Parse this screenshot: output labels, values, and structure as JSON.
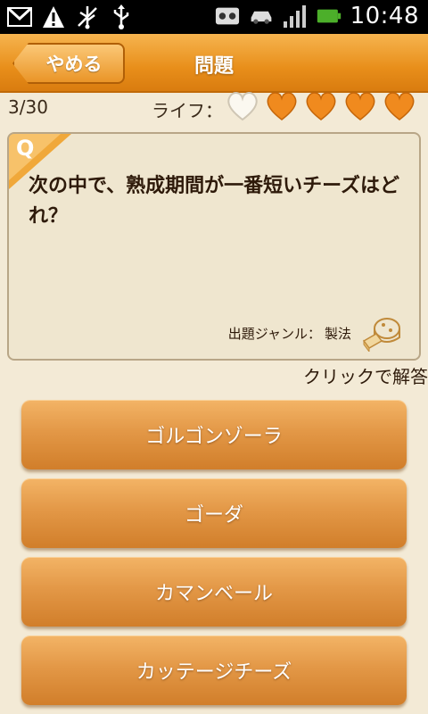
{
  "status_bar": {
    "time": "10:48",
    "icons": [
      "gmail-icon",
      "warning-icon",
      "usb-debug-icon",
      "usb-icon",
      "voicemail-icon",
      "car-icon",
      "signal-icon",
      "battery-icon"
    ],
    "battery_color": "#4caf2a"
  },
  "header": {
    "back_label": "やめる",
    "title": "問題",
    "accent": "#e88e1a"
  },
  "quiz": {
    "progress": "3/30",
    "life_label": "ライフ：",
    "lives_total": 5,
    "lives_remaining": 4
  },
  "question": {
    "badge": "Q",
    "text": "次の中で、熟成期間が一番短いチーズはどれ？",
    "genre_label": "出題ジャンル：",
    "genre_value": "製法",
    "hint": "クリックで解答"
  },
  "answers": [
    {
      "label": "ゴルゴンゾーラ"
    },
    {
      "label": "ゴーダ"
    },
    {
      "label": "カマンベール"
    },
    {
      "label": "カッテージチーズ"
    }
  ]
}
